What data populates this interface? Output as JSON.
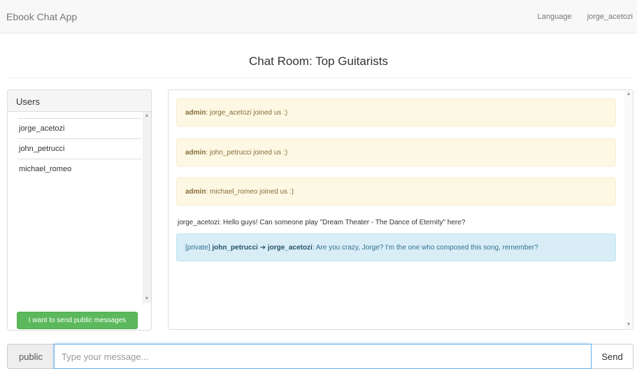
{
  "navbar": {
    "brand": "Ebook Chat App",
    "language_label": "Language",
    "username": "jorge_acetozi"
  },
  "page": {
    "title": "Chat Room: Top Guitarists"
  },
  "users_panel": {
    "heading": "Users",
    "users": [
      "jorge_acetozi",
      "john_petrucci",
      "michael_romeo"
    ],
    "public_button_label": "I want to send public messages"
  },
  "messages": [
    {
      "type": "system",
      "author": "admin",
      "separator": ":",
      "text": " jorge_acetozi joined us :)"
    },
    {
      "type": "system",
      "author": "admin",
      "separator": ":",
      "text": " john_petrucci joined us :)"
    },
    {
      "type": "system",
      "author": "admin",
      "separator": ":",
      "text": " michael_romeo joined us :)"
    },
    {
      "type": "public",
      "text": "jorge_acetozi: Hello guys! Can someone play \"Dream Theater - The Dance of Eternity\" here?"
    },
    {
      "type": "private",
      "tag": "[private]",
      "from_to": "john_petrucci ➔ jorge_acetozi",
      "separator": ":",
      "text": " Are you crazy, Jorge? I'm the one who composed this song, remember?"
    }
  ],
  "composer": {
    "mode_label": "public",
    "placeholder": "Type your message...",
    "value": "",
    "send_label": "Send"
  },
  "colors": {
    "send_public_button": "#5cb85c",
    "system_message_bg": "#fcf8e3",
    "private_message_bg": "#d9edf7",
    "input_focus_border": "#66afe9"
  }
}
